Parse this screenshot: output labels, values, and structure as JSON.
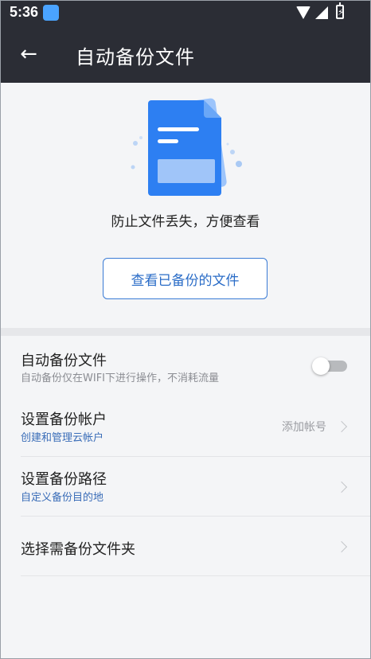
{
  "status_bar": {
    "time": "5:36",
    "icons": [
      "app-notification-icon",
      "wifi-icon",
      "signal-icon",
      "battery-charging-icon"
    ]
  },
  "app_bar": {
    "back_icon": "arrow-left-icon",
    "title": "自动备份文件"
  },
  "hero": {
    "illustration": "document-backup-icon",
    "tagline": "防止文件丢失，方便查看",
    "button_label": "查看已备份的文件"
  },
  "settings": [
    {
      "title": "自动备份文件",
      "subtitle": "自动备份仅在WIFI下进行操作，不消耗流量",
      "control": "toggle",
      "toggle_on": false
    },
    {
      "title": "设置备份帐户",
      "subtitle": "创建和管理云帐户",
      "value": "添加帐号",
      "control": "chevron"
    },
    {
      "title": "设置备份路径",
      "subtitle": "自定义备份目的地",
      "control": "chevron"
    },
    {
      "title": "选择需备份文件夹",
      "control": "chevron"
    }
  ],
  "colors": {
    "app_bar": "#2b2d35",
    "accent_blue": "#2a6cc7",
    "background": "#f4f5f7",
    "subtitle_blue": "#3a6db8"
  }
}
